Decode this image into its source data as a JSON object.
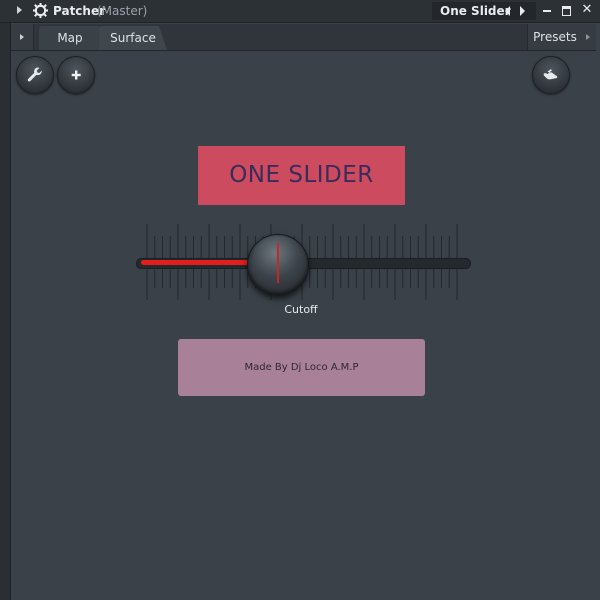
{
  "window": {
    "title": "Patcher",
    "subtitle": "(Master)",
    "preset_name": "One Slider",
    "close_glyph": "✕"
  },
  "tabs": [
    {
      "label": "Map"
    },
    {
      "label": "Surface"
    }
  ],
  "presets_label": "Presets",
  "tools": {
    "left": [
      "wrench-icon",
      "plus-icon"
    ],
    "right": "hand-icon"
  },
  "surface": {
    "title": "ONE SLIDER",
    "slider": {
      "label": "Cutoff",
      "value": 0.42
    },
    "credit": "Made By Dj Loco A.M.P"
  },
  "colors": {
    "title_bg": "#cc4b5e",
    "title_text": "#3a2c5a",
    "slider_fill": "#e41d1d",
    "credit_bg": "#a88098",
    "background": "#3a4148"
  }
}
